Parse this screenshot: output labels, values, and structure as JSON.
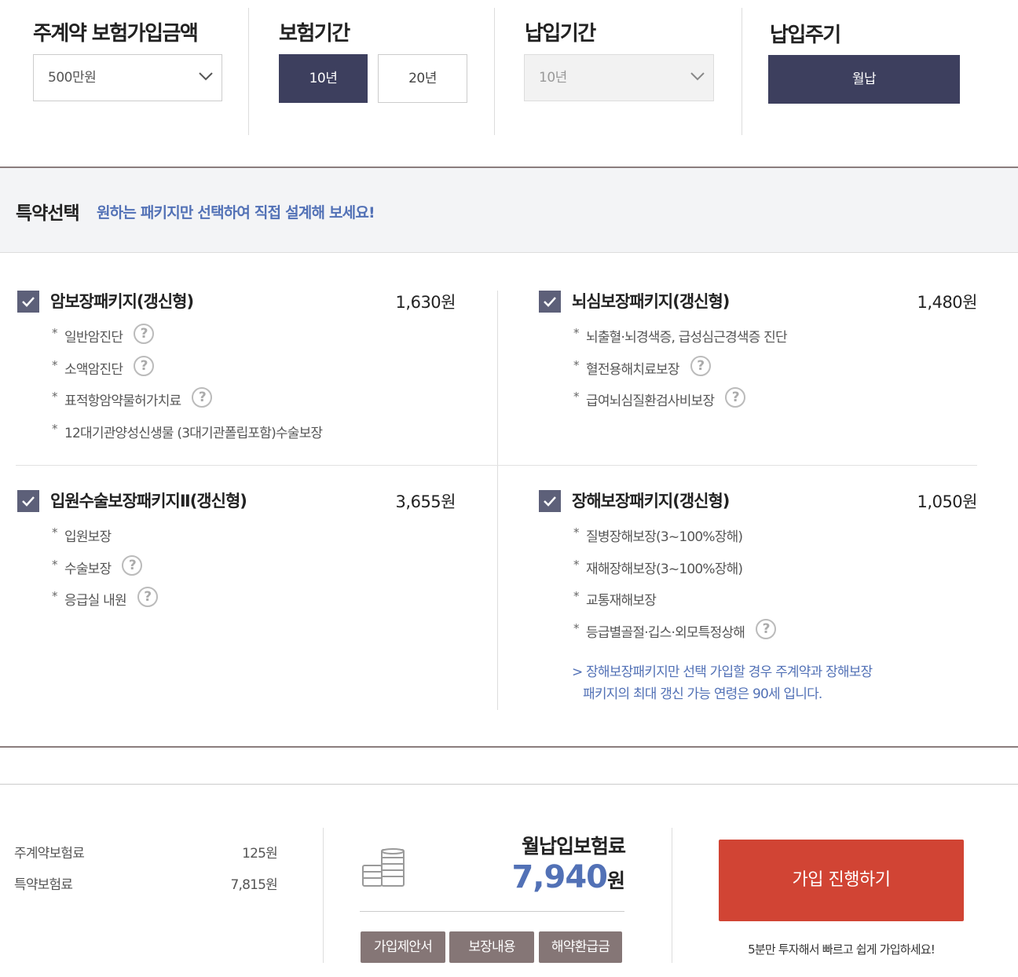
{
  "options": {
    "amount": {
      "title": "주계약 보험가입금액",
      "selected": "500만원"
    },
    "period": {
      "title": "보험기간",
      "buttons": [
        "10년",
        "20년"
      ],
      "active_index": 0
    },
    "pay_period": {
      "title": "납입기간",
      "selected": "10년",
      "disabled": true
    },
    "pay_cycle": {
      "title": "납입주기",
      "button": "월납"
    }
  },
  "rider": {
    "title": "특약선택",
    "subtitle": "원하는 패키지만 선택하여 직접 설계해 보세요!"
  },
  "packages": [
    {
      "name": "암보장패키지(갱신형)",
      "price": "1,630원",
      "checked": true,
      "items": [
        {
          "text": "일반암진단",
          "help": true
        },
        {
          "text": "소액암진단",
          "help": true
        },
        {
          "text": "표적항암약물허가치료",
          "help": true
        },
        {
          "text": "12대기관양성신생물 (3대기관폴립포함)수술보장",
          "help": false
        }
      ]
    },
    {
      "name": "뇌심보장패키지(갱신형)",
      "price": "1,480원",
      "checked": true,
      "items": [
        {
          "text": "뇌출혈·뇌경색증, 급성심근경색증 진단",
          "help": false
        },
        {
          "text": "혈전용해치료보장",
          "help": true
        },
        {
          "text": "급여뇌심질환검사비보장",
          "help": true
        }
      ]
    },
    {
      "name": "입원수술보장패키지Ⅱ(갱신형)",
      "price": "3,655원",
      "checked": true,
      "items": [
        {
          "text": "입원보장",
          "help": false
        },
        {
          "text": "수술보장",
          "help": true
        },
        {
          "text": "응급실 내원",
          "help": true
        }
      ]
    },
    {
      "name": "장해보장패키지(갱신형)",
      "price": "1,050원",
      "checked": true,
      "items": [
        {
          "text": "질병장해보장(3~100%장해)",
          "help": false
        },
        {
          "text": "재해장해보장(3~100%장해)",
          "help": false
        },
        {
          "text": "교통재해보장",
          "help": false
        },
        {
          "text": "등급별골절·깁스·외모특정상해",
          "help": true
        }
      ],
      "note": [
        "> 장해보장패키지만 선택 가입할 경우 주계약과 장해보장",
        "패키지의 최대 갱신 가능 연령은 90세 입니다."
      ]
    }
  ],
  "summary": {
    "main_label": "주계약보험료",
    "main_value": "125원",
    "rider_label": "특약보험료",
    "rider_value": "7,815원",
    "total_label": "월납입보험료",
    "total_value": "7,940",
    "total_unit": "원",
    "doc_buttons": [
      "가입제안서",
      "보장내용",
      "해약환급금"
    ],
    "join_button": "가입 진행하기",
    "join_sub": "5분만 투자해서 빠르고 쉽게 가입하세요!"
  },
  "colors": {
    "navy": "#3d3f5e",
    "checkbox": "#5d6079",
    "accent_blue": "#5271b6",
    "join_red": "#d14434",
    "doc_button": "#857676"
  },
  "icons": [
    "chevron-down-icon",
    "check-icon",
    "help-icon",
    "coins-icon"
  ]
}
